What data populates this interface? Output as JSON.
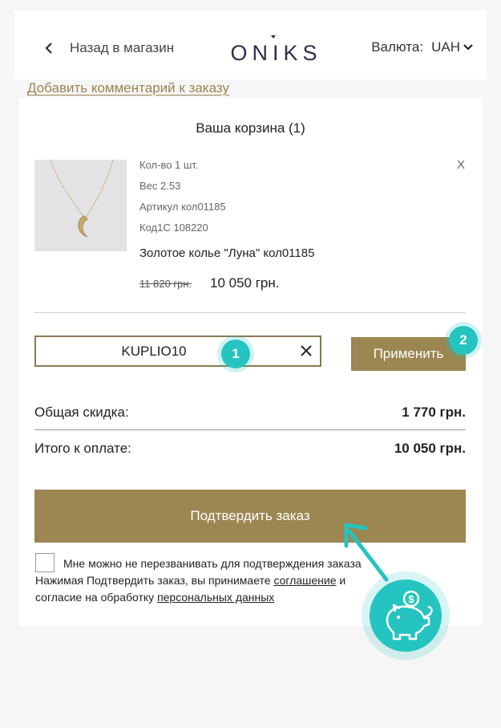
{
  "header": {
    "back_label": "Назад в магазин",
    "logo_text": "ONIKS",
    "currency_label": "Валюта:",
    "currency_value": "UAH"
  },
  "comment_link": "Добавить комментарий к заказу",
  "cart": {
    "title": "Ваша корзина (1)",
    "item": {
      "qty": "Кол-во 1 шт.",
      "weight": "Вес 2.53",
      "article": "Артикул кол01185",
      "code": "Код1С 108220",
      "name": "Золотое колье \"Луна\" кол01185",
      "old_price": "11 820 грн.",
      "price": "10 050 грн.",
      "remove_label": "X"
    }
  },
  "promo": {
    "value": "KUPLIO10",
    "apply_label": "Применить"
  },
  "badges": {
    "one": "1",
    "two": "2"
  },
  "totals": {
    "discount_label": "Общая скидка:",
    "discount_value": "1 770 грн.",
    "total_label": "Итого к оплате:",
    "total_value": "10 050 грн."
  },
  "confirm_label": "Подтвердить заказ",
  "footer": {
    "checkbox_label": "Мне можно не перезванивать для подтверждения заказа",
    "agree_prefix": "Нажимая Подтвердить заказ, вы принимаете ",
    "agree_link": "соглашение",
    "agree_suffix": " и ",
    "consent_prefix": "согласие на обработку ",
    "consent_link": "персональных данных"
  },
  "colors": {
    "accent": "#9c8651",
    "brand_navy": "#2b2f4a",
    "teal": "#25c4c0"
  },
  "icons": [
    "chevron-left-icon",
    "chevron-down-icon",
    "close-icon",
    "piggy-bank-icon",
    "arrow-icon"
  ]
}
